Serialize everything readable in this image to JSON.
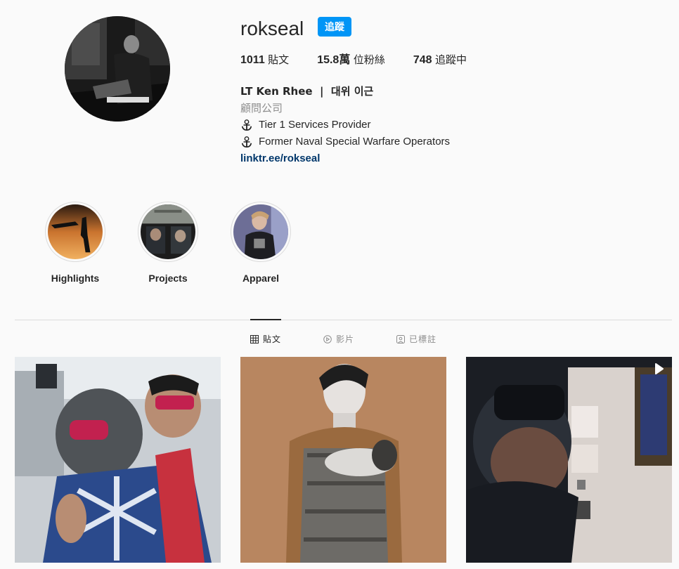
{
  "profile": {
    "username": "rokseal",
    "follow_label": "追蹤",
    "posts_count": "1011",
    "posts_label": "貼文",
    "followers_count": "15.8萬",
    "followers_label": "位粉絲",
    "following_count": "748",
    "following_label": "追蹤中"
  },
  "bio": {
    "name": "LT Ken Rhee  |  대위 이근",
    "category": "顧問公司",
    "line1": "Tier 1 Services Provider",
    "line2": "Former Naval Special Warfare Operators",
    "link": "linktr.ee/rokseal"
  },
  "highlights": [
    {
      "label": "Highlights"
    },
    {
      "label": "Projects"
    },
    {
      "label": "Apparel"
    }
  ],
  "tabs": [
    {
      "label": "貼文",
      "icon": "grid-icon",
      "active": true
    },
    {
      "label": "影片",
      "icon": "play-circle-icon",
      "active": false
    },
    {
      "label": "已標註",
      "icon": "tag-icon",
      "active": false
    }
  ],
  "colors": {
    "accent": "#0095f6",
    "link": "#00376b",
    "muted": "#8e8e8e"
  }
}
